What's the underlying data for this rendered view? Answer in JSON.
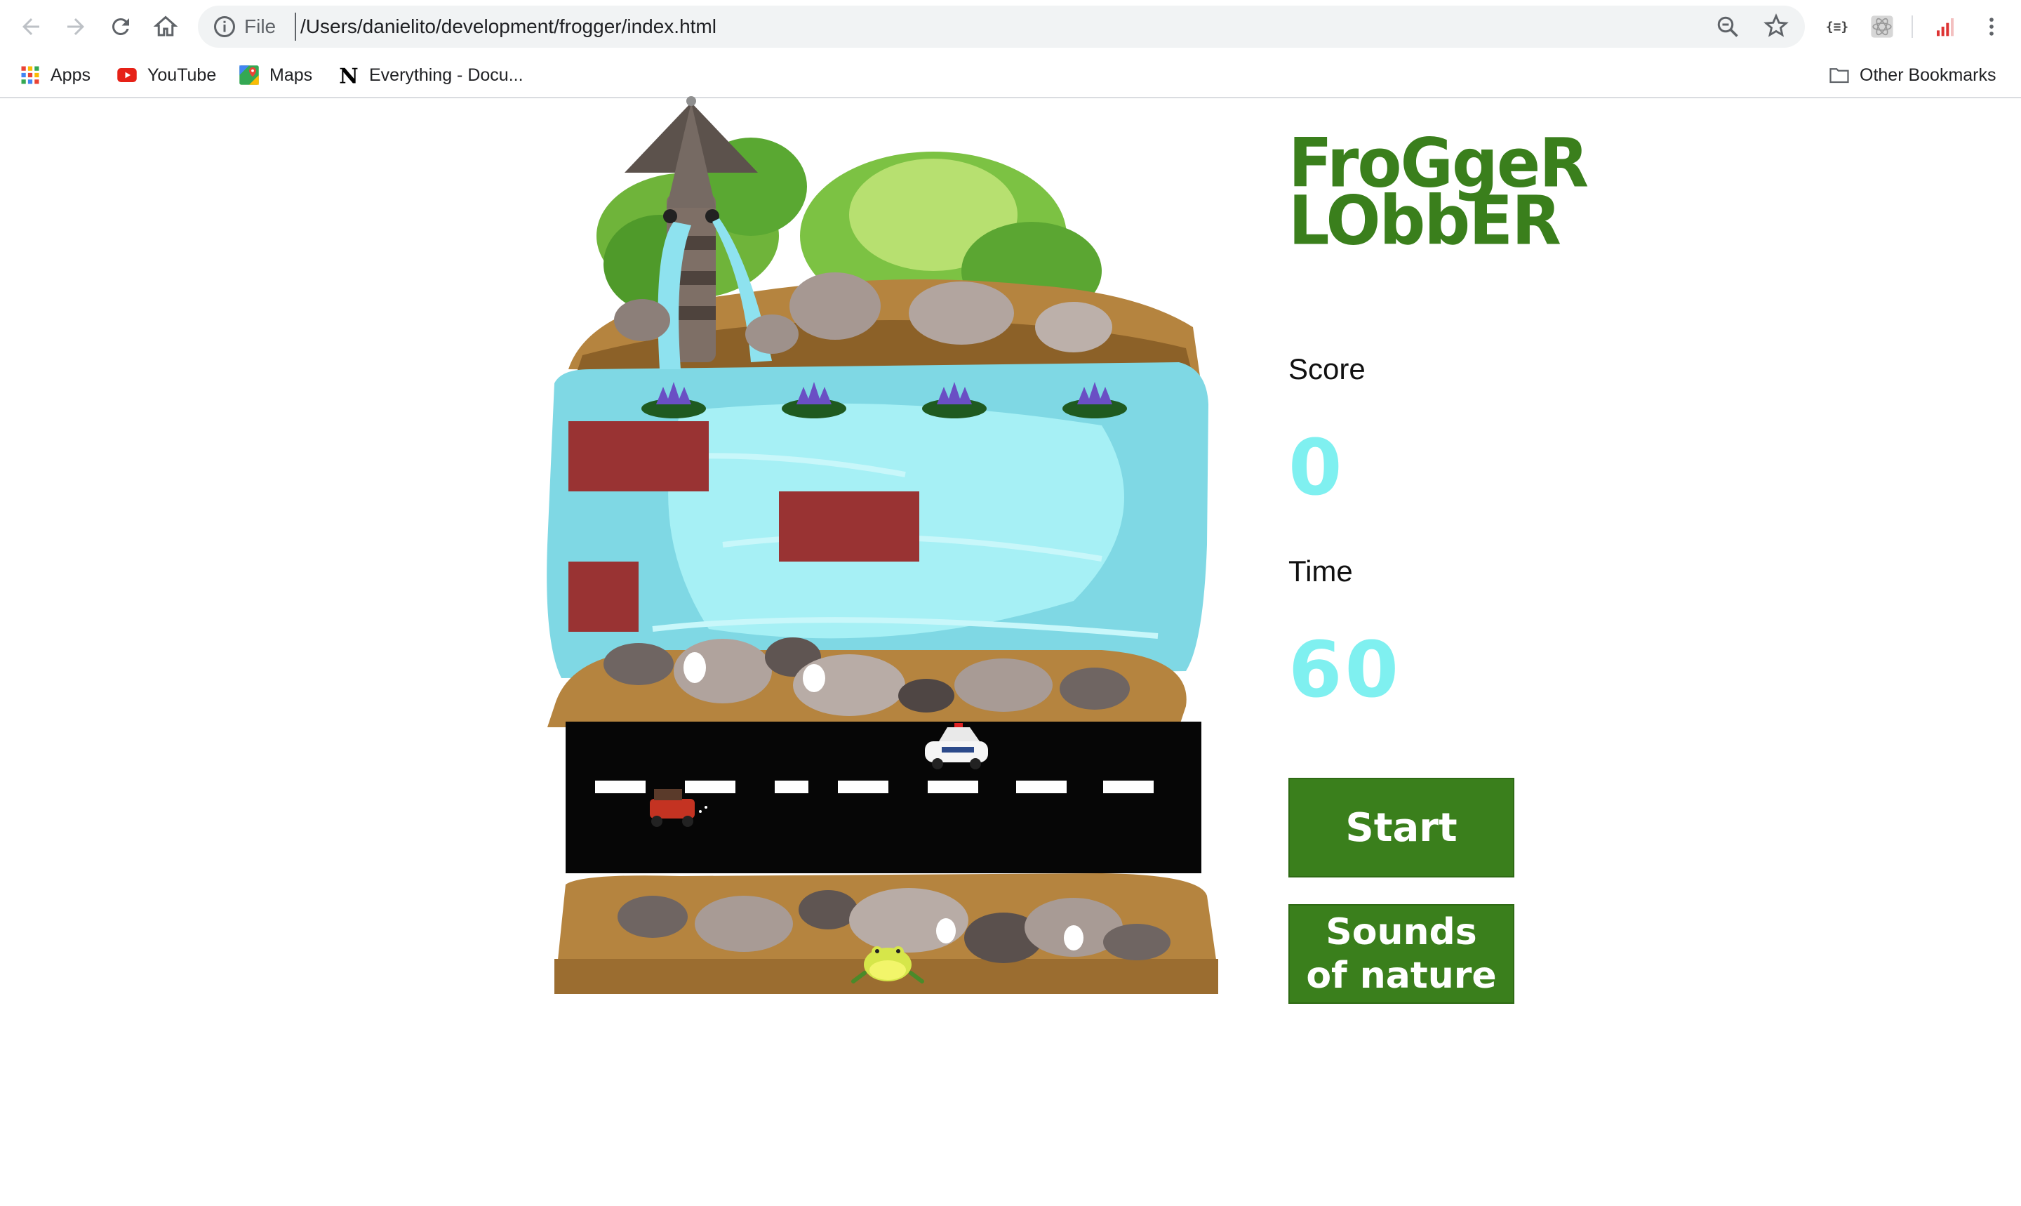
{
  "browser": {
    "url_scheme": "File",
    "url": "/Users/danielito/development/frogger/index.html",
    "extensions": {
      "json_viewer_label": "{≡}"
    }
  },
  "bookmarks": [
    {
      "label": "Apps",
      "icon": "apps-grid-icon"
    },
    {
      "label": "YouTube",
      "icon": "youtube-icon"
    },
    {
      "label": "Maps",
      "icon": "maps-icon"
    },
    {
      "label": "Everything - Docu...",
      "icon": "notion-icon"
    }
  ],
  "other_bookmarks": "Other Bookmarks",
  "game": {
    "title_line1": "FroGgeR",
    "title_line2": "LObbER",
    "score_label": "Score",
    "score_value": "0",
    "time_label": "Time",
    "time_value": "60",
    "start_button": "Start",
    "sounds_button": "Sounds of nature",
    "colors": {
      "brand_green": "#3a7f1c",
      "number_cyan": "#7ff0f0",
      "log_red": "#993333",
      "road_black": "#060606",
      "water": "#7fd8e4"
    }
  }
}
